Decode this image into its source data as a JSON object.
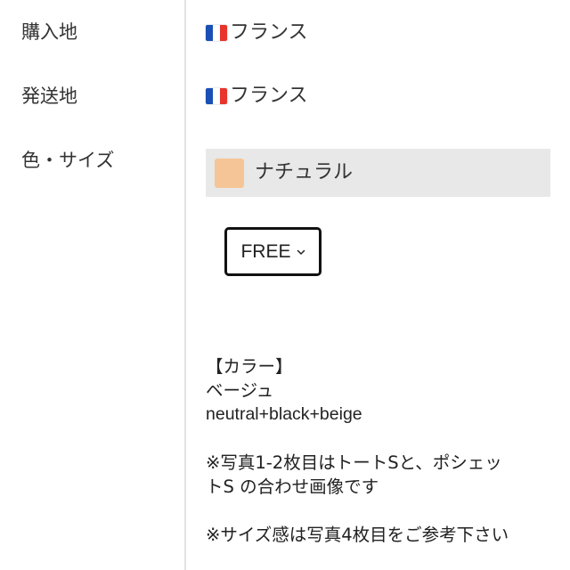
{
  "details": {
    "purchase_location_label": "購入地",
    "purchase_location_value": "フランス",
    "shipping_location_label": "発送地",
    "shipping_location_value": "フランス",
    "variant_label": "色・サイズ",
    "flag_icon": "france-flag-icon",
    "flag_colors": [
      "#1a4fb5",
      "#ffffff",
      "#e8342c"
    ]
  },
  "variant": {
    "color_name": "ナチュラル",
    "swatch_color": "#f6c597",
    "size_selected": "FREE",
    "size_icon": "chevron-down-icon"
  },
  "description": {
    "line1": "【カラー】",
    "line2": "ベージュ",
    "line3": "neutral+black+beige",
    "line4": "※写真1-2枚目はトートSと、ポシェッ",
    "line5": "トS の合わせ画像です",
    "line6": "※サイズ感は写真4枚目をご参考下さい"
  }
}
